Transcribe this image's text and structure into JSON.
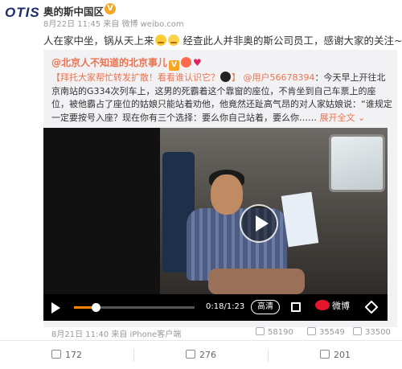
{
  "header": {
    "logo_text": "OTIS",
    "author": "奥的斯中国区",
    "verified": "V",
    "meta": "8月22日 11:45 来自 微博 weibo.com"
  },
  "post": {
    "text_a": "人在家中坐，锅从天上来",
    "text_b": "经查此人并非奥的斯公司员工，感谢大家的关注~",
    "emoji_1": "cry-emoji",
    "emoji_2": "sweat-emoji"
  },
  "repost": {
    "author": "@北京人不知道的北京事儿",
    "badge": "V",
    "intro": "【拜托大家帮忙转发扩散！看看谁认识它？",
    "intro_end": "】",
    "mention": "@用户56678394",
    "body": "：今天早上开往北京南站的G334次列车上，这男的死霸着这个靠窗的座位，不肯坐到自己车票上的座位，被他霸占了座位的姑娘只能站着劝他，他竟然还趾高气昂的对人家姑娘说：“谁规定一定要按号入座？现在你有三个选择：要么你自己站着，要么你……",
    "expand": "展开全文 ⌄",
    "meta": "8月21日 11:40 来自 iPhone客户端",
    "reposts": "58190",
    "comments": "35549",
    "likes": "33500"
  },
  "video": {
    "progress": 0.18,
    "time": "0:18/1:23",
    "quality": "高清",
    "brand": "微博",
    "icons": [
      "play-icon",
      "shrink-icon",
      "weibo-logo-icon",
      "fullscreen-icon"
    ]
  },
  "actions": {
    "repost": "172",
    "comment": "276",
    "like": "201"
  },
  "colors": {
    "accent": "#eb7350",
    "progress": "#ff8200",
    "weibo_red": "#e6162d"
  }
}
